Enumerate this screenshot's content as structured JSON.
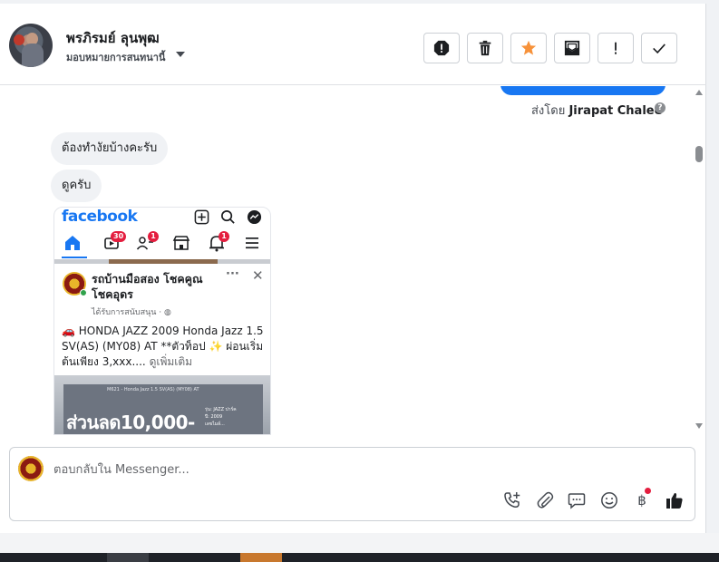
{
  "header": {
    "contact_name": "พรภิรมย์ ลุนพุฒ",
    "assign_label": "มอบหมายการสนทนานี้",
    "tools": [
      {
        "name": "mark-spam-button",
        "icon": "alert-octagon-icon"
      },
      {
        "name": "delete-button",
        "icon": "trash-icon"
      },
      {
        "name": "star-button",
        "icon": "star-icon"
      },
      {
        "name": "mark-unread-button",
        "icon": "envelope-icon"
      },
      {
        "name": "follow-up-button",
        "icon": "exclamation-icon"
      },
      {
        "name": "mark-done-button",
        "icon": "check-icon"
      }
    ]
  },
  "conversation": {
    "sent_by_prefix": "ส่งโดย",
    "sent_by_name": "Jirapat Chalee",
    "help_glyph": "?",
    "messages": [
      {
        "text": "ต้องทำงัยบ้างคะรับ"
      },
      {
        "text": "ดูครับ"
      }
    ]
  },
  "screenshot": {
    "app_name": "facebook",
    "badges": {
      "video": "30",
      "friends": "1",
      "notifications": "1"
    },
    "post": {
      "page_name": "รถบ้านมือสอง โชคคูณ โชคอุดร",
      "sponsored": "ได้รับการสนับสนุน · ",
      "text": "🚗 HONDA JAZZ 2009 Honda Jazz 1.5 SV(AS) (MY08) AT **ตัวท็อป ✨ ผ่อนเริ่มต้นเพียง 3,xxx....",
      "see_more": "ดูเพิ่มเติม",
      "dots": "···",
      "close": "✕",
      "image_caption": "M621 - Honda Jazz 1.5 SV(AS) (MY08) AT",
      "image_promo": "ส่วนลด10,000-",
      "image_specs": [
        "รุ่น: JAZZ ปาร์ค",
        "ปี: 2009",
        "เลขไมล์..."
      ]
    }
  },
  "composer": {
    "placeholder": "ตอบกลับใน Messenger...",
    "baht_glyph": "฿"
  },
  "colors": {
    "accent": "#1877f2",
    "star": "#f7923a",
    "badge": "#e41e3f"
  }
}
